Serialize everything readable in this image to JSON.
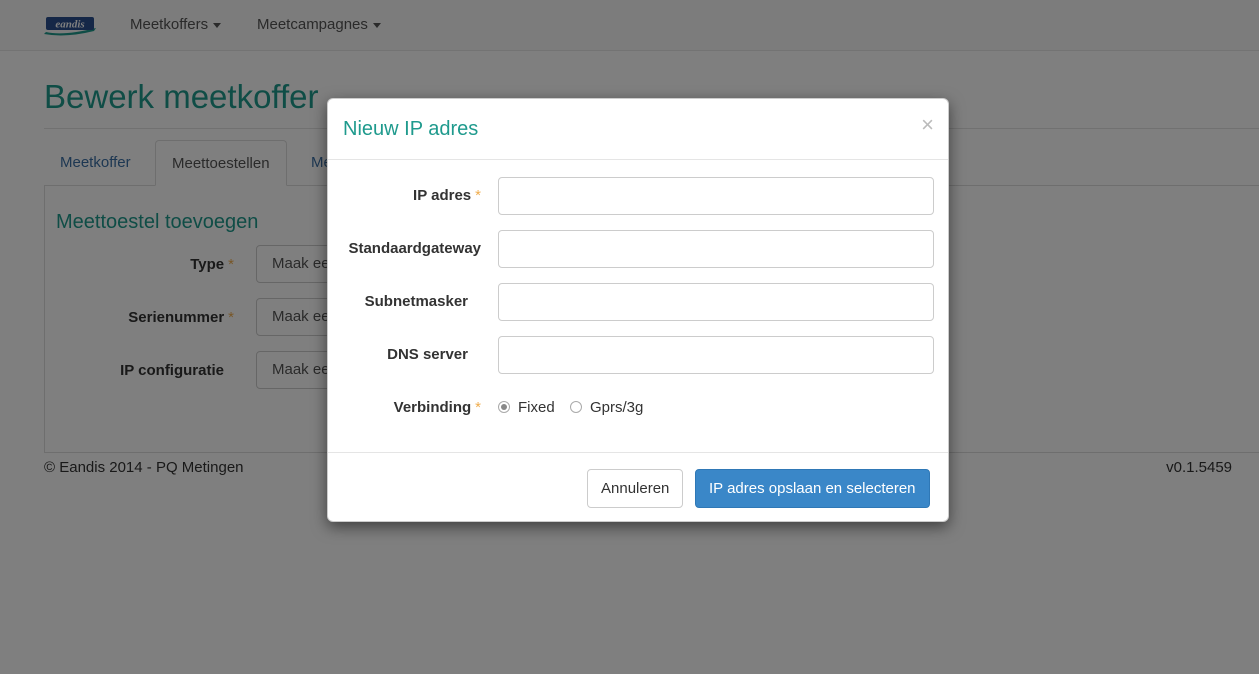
{
  "navbar": {
    "brand": "eandis",
    "items": [
      {
        "label": "Meetkoffers"
      },
      {
        "label": "Meetcampagnes"
      }
    ]
  },
  "page": {
    "title": "Bewerk meetkoffer",
    "tabs": [
      {
        "label": "Meetkoffer"
      },
      {
        "label": "Meettoestellen"
      },
      {
        "label": "Me"
      }
    ],
    "section_title": "Meettoestel toevoegen",
    "fields": [
      {
        "label": "Type",
        "required": "*",
        "value": "Maak ee"
      },
      {
        "label": "Serienummer",
        "required": "*",
        "value": "Maak ee"
      },
      {
        "label": "IP configuratie",
        "required": "",
        "value": "Maak ee"
      }
    ]
  },
  "footer": {
    "copyright": "© Eandis 2014 - PQ Metingen",
    "version": "v0.1.5459"
  },
  "modal": {
    "title": "Nieuw IP adres",
    "close": "×",
    "fields": [
      {
        "label": "IP adres",
        "required": "*",
        "value": ""
      },
      {
        "label": "Standaardgateway",
        "required": "",
        "value": ""
      },
      {
        "label": "Subnetmasker",
        "required": "",
        "value": ""
      },
      {
        "label": "DNS server",
        "required": "",
        "value": ""
      }
    ],
    "connection": {
      "label": "Verbinding",
      "required": "*",
      "options": [
        {
          "label": "Fixed",
          "checked": true
        },
        {
          "label": "Gprs/3g",
          "checked": false
        }
      ]
    },
    "cancel_label": "Annuleren",
    "submit_label": "IP adres opslaan en selecteren"
  }
}
